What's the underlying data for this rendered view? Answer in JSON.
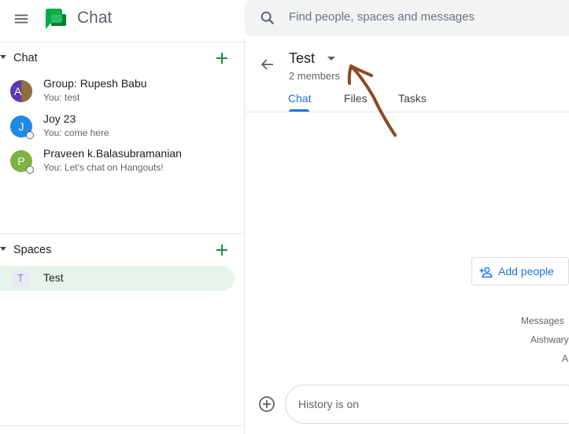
{
  "app": {
    "title": "Chat"
  },
  "search": {
    "placeholder": "Find people, spaces and messages"
  },
  "sidebar": {
    "chat_section": {
      "label": "Chat",
      "items": [
        {
          "name": "Group: Rupesh Babu",
          "preview": "You: test",
          "avatar_letter": "A",
          "avatar_color": "#5e35b1"
        },
        {
          "name": "Joy 23",
          "preview": "You: come here",
          "avatar_letter": "J",
          "avatar_color": "#1e88e5"
        },
        {
          "name": "Praveen k.Balasubramanian",
          "preview": "You: Let's chat on Hangouts!",
          "avatar_letter": "P",
          "avatar_color": "#7cb342"
        }
      ]
    },
    "spaces_section": {
      "label": "Spaces",
      "items": [
        {
          "name": "Test",
          "avatar_letter": "T"
        }
      ]
    }
  },
  "room": {
    "title": "Test",
    "members": "2 members",
    "tabs": [
      {
        "label": "Chat"
      },
      {
        "label": "Files"
      },
      {
        "label": "Tasks"
      }
    ]
  },
  "main": {
    "add_people_label": "Add people",
    "system_lines": [
      "Messages",
      "Aishwary",
      "A"
    ]
  },
  "composer": {
    "placeholder": "History is on"
  },
  "colors": {
    "accent": "#1a73e8",
    "selected_bg": "#e6f4ea",
    "plus_green": "#1e8e3e",
    "annotation": "#8b4a22"
  }
}
